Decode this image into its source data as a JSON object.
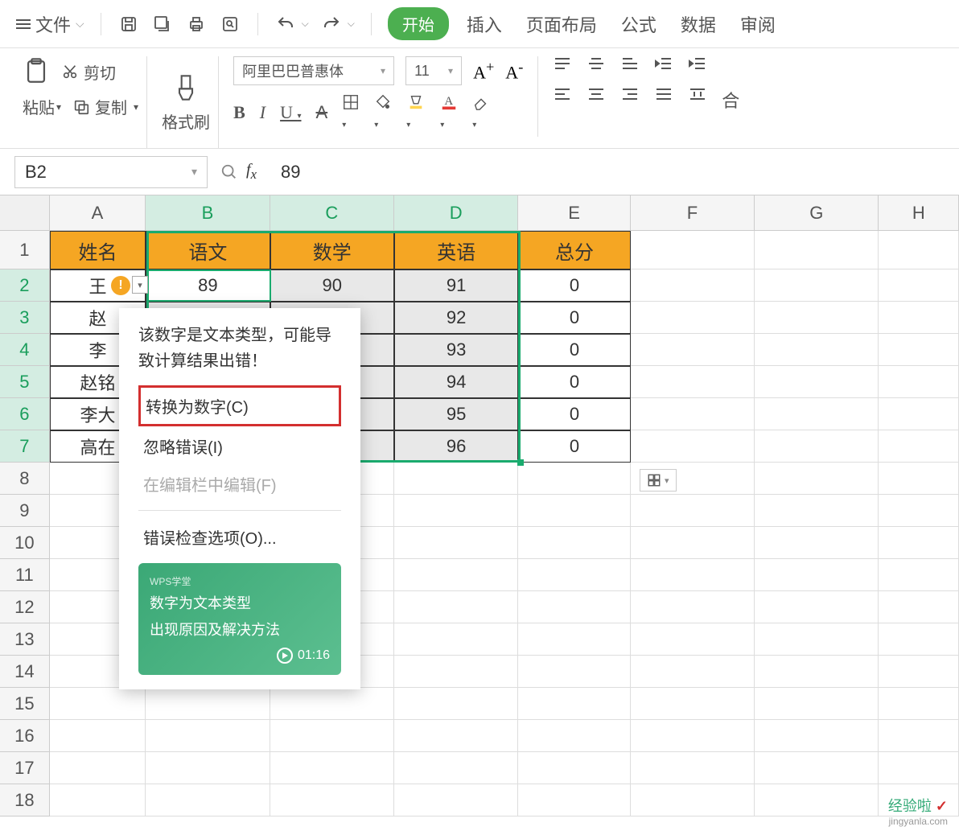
{
  "topbar": {
    "file": "文件",
    "tabs": {
      "start": "开始",
      "insert": "插入",
      "layout": "页面布局",
      "formula": "公式",
      "data": "数据",
      "review": "审阅"
    }
  },
  "ribbon": {
    "paste": "粘贴",
    "cut": "剪切",
    "copy": "复制",
    "brush": "格式刷",
    "font_name": "阿里巴巴普惠体",
    "font_size": "11"
  },
  "namebox": "B2",
  "formula_value": "89",
  "columns": [
    "A",
    "B",
    "C",
    "D",
    "E",
    "F",
    "G",
    "H"
  ],
  "headers": {
    "name": "姓名",
    "chinese": "语文",
    "math": "数学",
    "english": "英语",
    "total": "总分"
  },
  "rows": [
    {
      "n": "2",
      "name": "王",
      "b": "89",
      "c": "90",
      "d": "91",
      "e": "0"
    },
    {
      "n": "3",
      "name": "赵",
      "b": "",
      "c": "",
      "d": "92",
      "e": "0"
    },
    {
      "n": "4",
      "name": "李",
      "b": "",
      "c": "",
      "d": "93",
      "e": "0"
    },
    {
      "n": "5",
      "name": "赵铭",
      "b": "",
      "c": "",
      "d": "94",
      "e": "0"
    },
    {
      "n": "6",
      "name": "李大",
      "b": "",
      "c": "",
      "d": "95",
      "e": "0"
    },
    {
      "n": "7",
      "name": "高在",
      "b": "",
      "c": "",
      "d": "96",
      "e": "0"
    }
  ],
  "extra_rows": [
    "8",
    "9",
    "10",
    "11",
    "12",
    "13",
    "14",
    "15",
    "16",
    "17",
    "18"
  ],
  "popup": {
    "message": "该数字是文本类型，可能导致计算结果出错！",
    "convert": "转换为数字(C)",
    "ignore": "忽略错误(I)",
    "edit_bar": "在编辑栏中编辑(F)",
    "options": "错误检查选项(O)...",
    "video_tag": "WPS学堂",
    "video_title1": "数字为文本类型",
    "video_title2": "出现原因及解决方法",
    "video_time": "01:16"
  },
  "watermark": {
    "text": "经验啦",
    "url": "jingyanla.com"
  }
}
